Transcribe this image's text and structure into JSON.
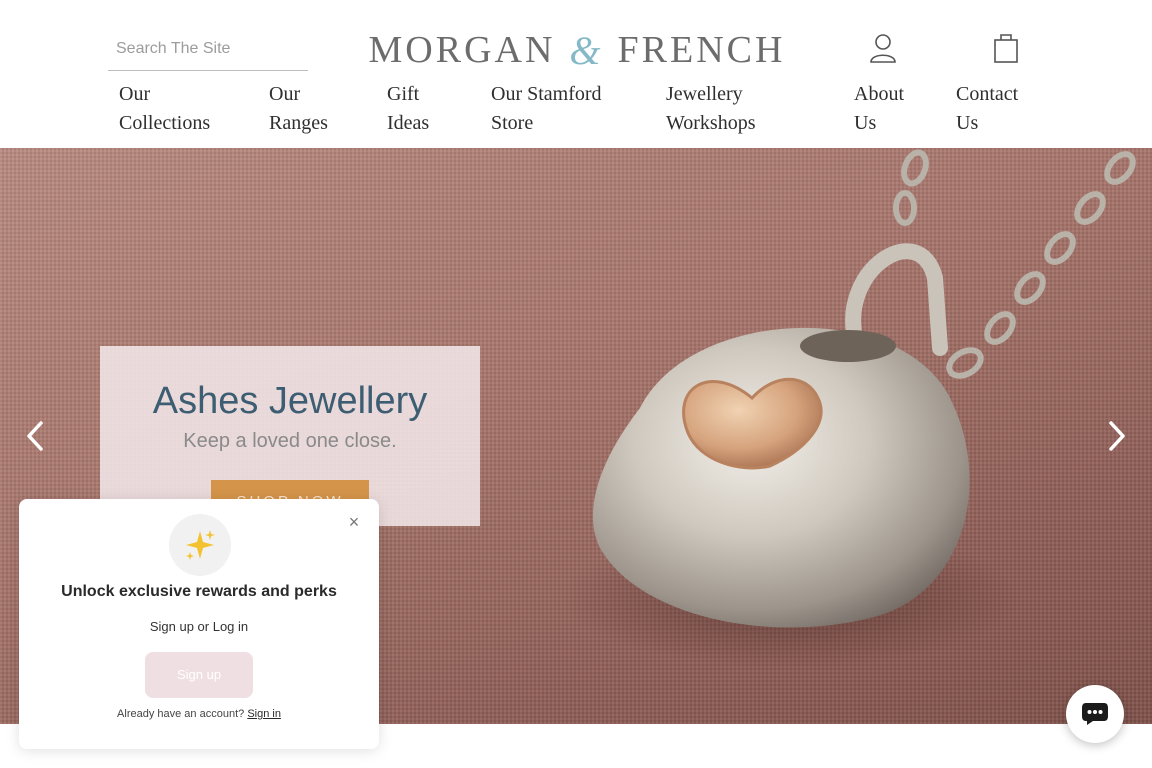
{
  "search": {
    "placeholder": "Search The Site"
  },
  "brand": {
    "name_left": "MORGAN",
    "ampersand": "&",
    "name_right": "FRENCH"
  },
  "header_icons": {
    "account": "user-icon",
    "cart": "shopping-bag-icon"
  },
  "nav": [
    {
      "line1": "Our",
      "line2": "Collections"
    },
    {
      "line1": "Our",
      "line2": "Ranges"
    },
    {
      "line1": "Gift",
      "line2": "Ideas"
    },
    {
      "line1": "Our Stamford",
      "line2": "Store"
    },
    {
      "line1": "Jewellery",
      "line2": "Workshops"
    },
    {
      "line1": "About",
      "line2": "Us"
    },
    {
      "line1": "Contact",
      "line2": "Us"
    }
  ],
  "hero": {
    "title": "Ashes Jewellery",
    "subtitle": "Keep a loved one close.",
    "cta": "SHOP NOW"
  },
  "popup": {
    "close": "×",
    "title": "Unlock exclusive rewards and perks",
    "subtitle": "Sign up or Log in",
    "signup": "Sign up",
    "footer_text": "Already have an account?",
    "footer_link": "Sign in"
  },
  "colors": {
    "accent": "#86b9c7",
    "cta": "#d4944a",
    "hero_title": "#3d5d73"
  }
}
